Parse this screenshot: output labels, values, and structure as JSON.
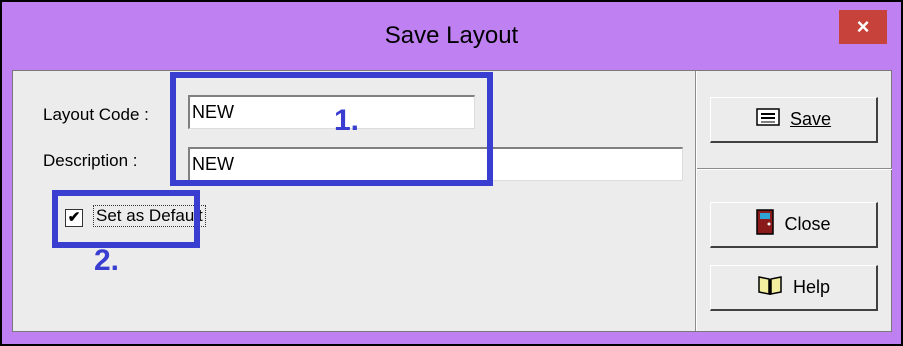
{
  "dialog": {
    "title": "Save Layout",
    "close_glyph": "×"
  },
  "form": {
    "layout_code_label": "Layout Code :",
    "layout_code_value": "NEW",
    "description_label": "Description :",
    "description_value": "NEW",
    "default_checkbox_label": "Set as Default",
    "default_checked": true,
    "check_glyph": "✔"
  },
  "buttons": {
    "save_label": "Save",
    "close_label": "Close",
    "help_label": "Help"
  },
  "annotations": {
    "label_1": "1.",
    "label_2": "2.",
    "color": "#3a3ed0"
  },
  "colors": {
    "titlebar": "#bf80f2",
    "close_button": "#c7423b",
    "client": "#ececec"
  },
  "icons": [
    "close-icon",
    "save-icon",
    "door-icon",
    "book-icon"
  ]
}
